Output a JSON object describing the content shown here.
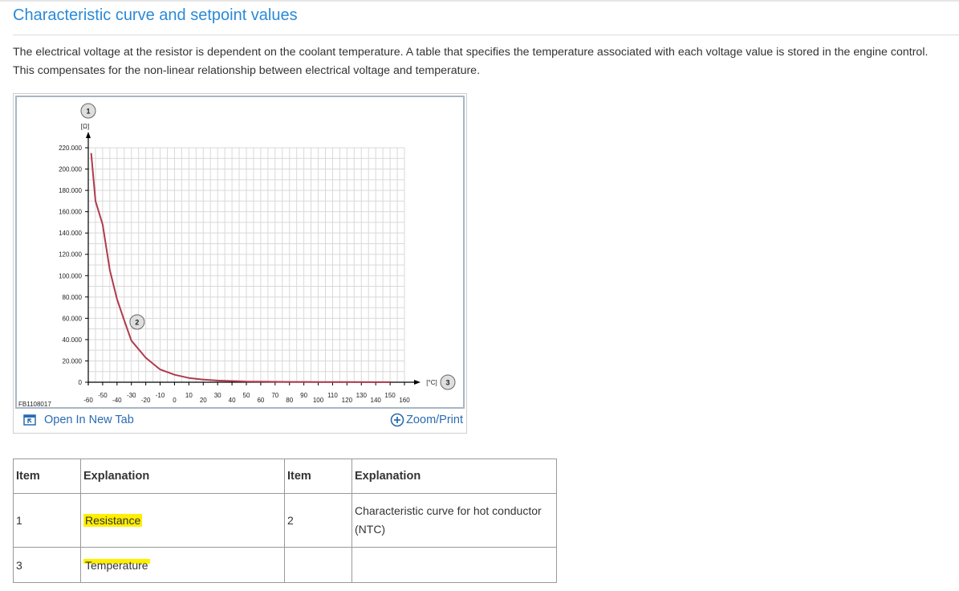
{
  "page": {
    "title": "Characteristic curve and setpoint values",
    "intro": "The electrical voltage at the resistor is dependent on the coolant temperature. A table that specifies the temperature associated with each voltage value is stored in the engine control. This compensates for the non-linear relationship between electrical voltage and temperature."
  },
  "figure": {
    "code": "FB1108017",
    "open_tab_label": "Open In New Tab",
    "zoom_label": "Zoom/Print",
    "y_unit": "[Ω]",
    "x_unit": "[°C]",
    "callouts": [
      "1",
      "2",
      "3"
    ],
    "link_color": "#2a6bb0",
    "curve_color": "#b03a4e"
  },
  "chart_data": {
    "type": "line",
    "x_tick_labels": [
      "-60",
      "-50",
      "-40",
      "-30",
      "-20",
      "-10",
      "0",
      "10",
      "20",
      "30",
      "40",
      "50",
      "60",
      "70",
      "80",
      "90",
      "100",
      "110",
      "120",
      "130",
      "140",
      "150",
      "160"
    ],
    "y_tick_labels": [
      "0",
      "20.000",
      "40.000",
      "60.000",
      "80.000",
      "100.000",
      "120.000",
      "140.000",
      "160.000",
      "180.000",
      "200.000",
      "220.000"
    ],
    "xlim": [
      -60,
      160
    ],
    "ylim": [
      0,
      220000
    ],
    "grid": true,
    "series": [
      {
        "x": [
          -58,
          -55,
          -50,
          -45,
          -40,
          -35,
          -30,
          -20,
          -10,
          0,
          10,
          20,
          30,
          40,
          50,
          60,
          80,
          100,
          120,
          140,
          150
        ],
        "y": [
          215000,
          170000,
          148000,
          105000,
          78000,
          58000,
          39000,
          23000,
          12000,
          7000,
          4000,
          2500,
          1600,
          1100,
          700,
          500,
          300,
          200,
          120,
          80,
          60
        ]
      }
    ]
  },
  "table": {
    "headers": [
      "Item",
      "Explanation",
      "Item",
      "Explanation"
    ],
    "rows": [
      [
        "1",
        "Resistance",
        "2",
        "Characteristic curve for hot conductor (NTC)"
      ],
      [
        "3",
        "Temperature",
        "",
        ""
      ]
    ]
  }
}
